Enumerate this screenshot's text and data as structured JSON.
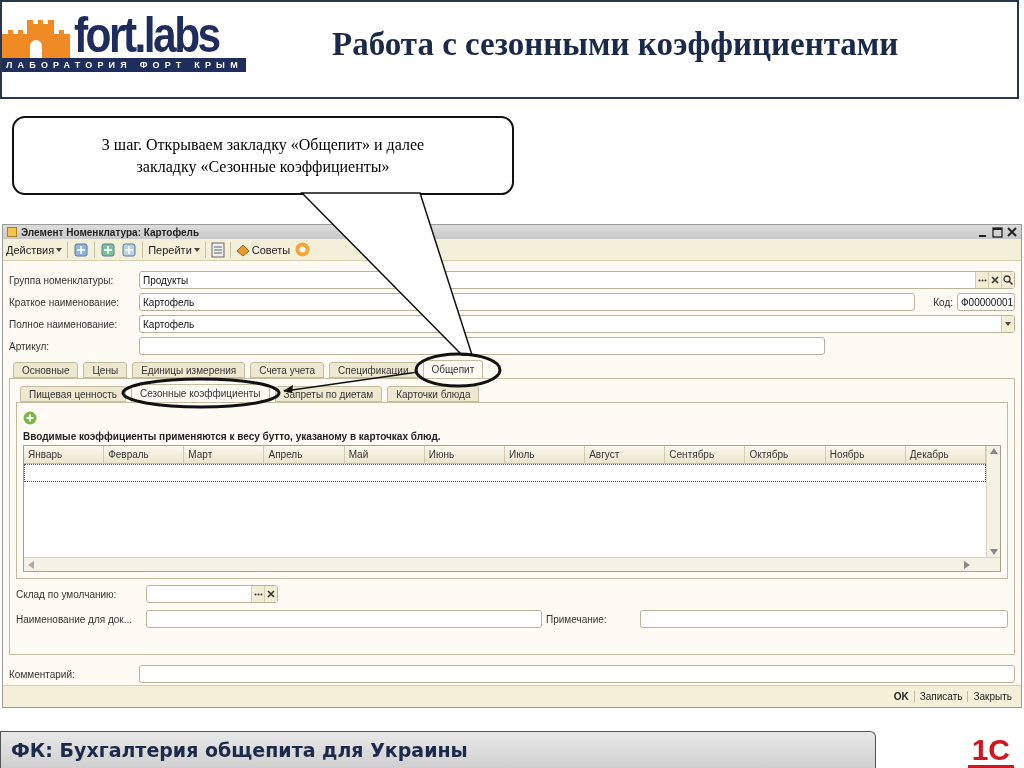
{
  "header": {
    "logo": {
      "wordmark": "fort.labs",
      "tagline": "ЛАБОРАТОРИЯ ФОРТ КРЫМ"
    },
    "title": "Работа с сезонными коэффициентами"
  },
  "callout": {
    "text": "3 шаг. Открываем закладку «Общепит» и далее закладку «Сезонные коэффициенты»"
  },
  "window": {
    "title": "Элемент Номенклатура: Картофель",
    "toolbar": {
      "actions": "Действия",
      "goto": "Перейти",
      "tips": "Советы"
    },
    "fields": [
      {
        "label": "Группа номенклатуры:",
        "value": "Продукты",
        "kind": "picker"
      },
      {
        "label": "Краткое наименование:",
        "value": "Картофель",
        "kind": "text",
        "code": {
          "label": "Код:",
          "value": "Ф00000001"
        }
      },
      {
        "label": "Полное наименование:",
        "value": "Картофель",
        "kind": "dropdown"
      },
      {
        "label": "Артикул:",
        "kind": "short"
      }
    ],
    "main_tabs": [
      {
        "label": "Основные",
        "selected": false
      },
      {
        "label": "Цены",
        "selected": false
      },
      {
        "label": "Единицы измерения",
        "selected": false
      },
      {
        "label": "Счета учета",
        "selected": false
      },
      {
        "label": "Спецификации",
        "selected": false
      },
      {
        "label": "Общепит",
        "selected": true
      }
    ],
    "sub_tabs": [
      {
        "label": "Пищевая ценность",
        "selected": false
      },
      {
        "label": "Сезонные коэффициенты",
        "selected": true
      },
      {
        "label": "Запреты по диетам",
        "selected": false
      },
      {
        "label": "Карточки блюда",
        "selected": false
      }
    ],
    "table_note": "Вводимые коэффициенты применяются к весу бутто, указаному в карточках блюд.",
    "columns": [
      "Январь",
      "Февраль",
      "Март",
      "Апрель",
      "Май",
      "Июнь",
      "Июль",
      "Август",
      "Сентябрь",
      "Октябрь",
      "Ноябрь",
      "Декабрь"
    ],
    "warehouse": {
      "label": "Склад по умолчанию:"
    },
    "doc_name": {
      "label": "Наименование для док..."
    },
    "remark": {
      "label": "Примечание:"
    },
    "comment": {
      "label": "Комментарий:"
    },
    "buttons": [
      {
        "label": "OK",
        "default": true
      },
      {
        "label": "Записать",
        "default": false
      },
      {
        "label": "Закрыть",
        "default": false
      }
    ]
  },
  "footer": {
    "title": "ФК: Бухгалтерия общепита для Украины",
    "logo": "1С"
  }
}
